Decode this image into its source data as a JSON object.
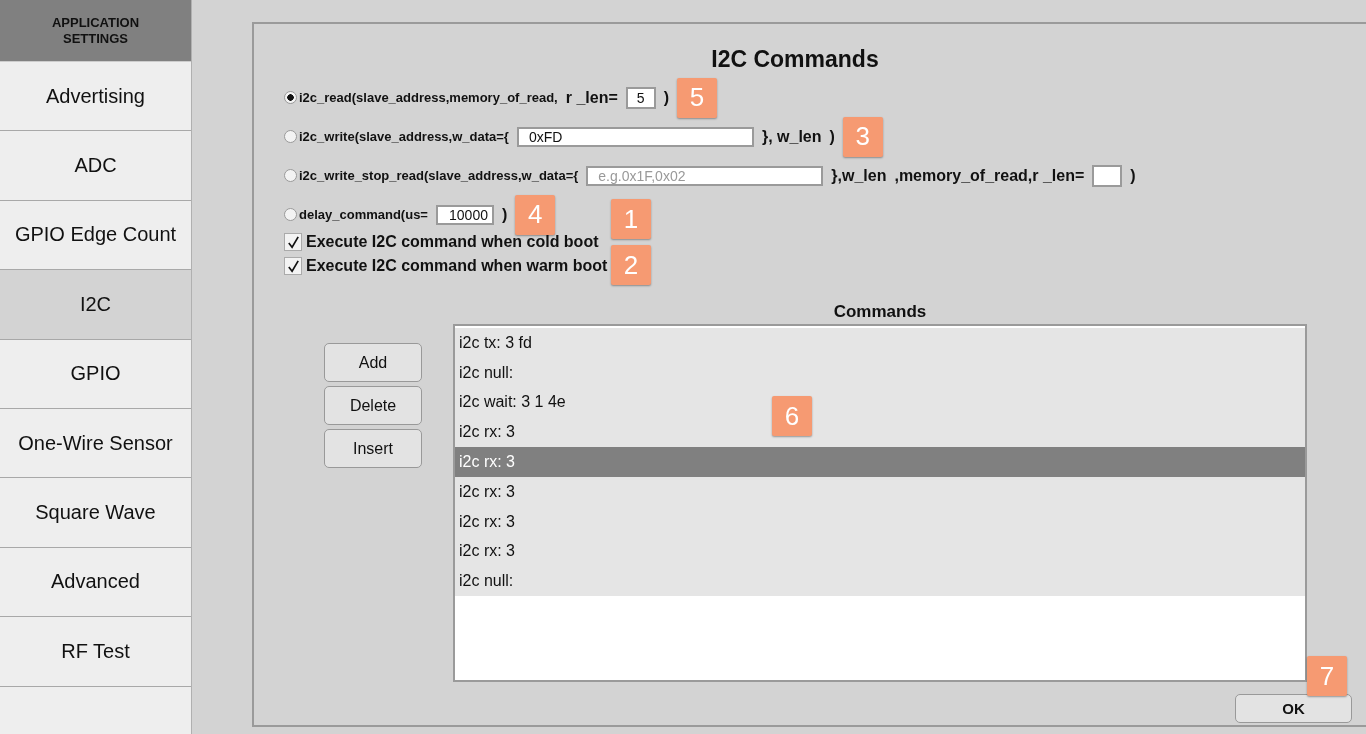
{
  "sidebar": {
    "header": "APPLICATION SETTINGS",
    "items": [
      {
        "label": "Advertising",
        "selected": false
      },
      {
        "label": "ADC",
        "selected": false
      },
      {
        "label": "GPIO Edge Count",
        "selected": false
      },
      {
        "label": "I2C",
        "selected": true
      },
      {
        "label": "GPIO",
        "selected": false
      },
      {
        "label": "One-Wire Sensor",
        "selected": false
      },
      {
        "label": "Square Wave",
        "selected": false
      },
      {
        "label": "Advanced",
        "selected": false
      },
      {
        "label": "RF Test",
        "selected": false
      }
    ]
  },
  "panel": {
    "title": "I2C Commands",
    "options": [
      {
        "kind": "radio",
        "selected": true,
        "parts": [
          {
            "kind": "text",
            "text": "i2c_read(slave_address,memory_of_read,"
          },
          {
            "kind": "label",
            "text": "r _len="
          },
          {
            "kind": "small-field",
            "value": "5"
          },
          {
            "kind": "label",
            "text": ")"
          },
          {
            "kind": "callout",
            "text": "5"
          }
        ]
      },
      {
        "kind": "radio",
        "selected": false,
        "parts": [
          {
            "kind": "text",
            "text": "i2c_write(slave_address,w_data={"
          },
          {
            "kind": "wide-field",
            "value": "0xFD"
          },
          {
            "kind": "label",
            "text": "}, w_len"
          },
          {
            "kind": "label",
            "text": ")"
          },
          {
            "kind": "callout",
            "text": "3"
          }
        ]
      },
      {
        "kind": "radio",
        "selected": false,
        "parts": [
          {
            "kind": "text",
            "text": "i2c_write_stop_read(slave_address,w_data={"
          },
          {
            "kind": "wide-field",
            "placeholder": "e.g.0x1F,0x02"
          },
          {
            "kind": "label",
            "text": "},w_len"
          },
          {
            "kind": "label",
            "text": ",memory_of_read,r _len="
          },
          {
            "kind": "small-field"
          },
          {
            "kind": "label",
            "text": ")"
          }
        ]
      },
      {
        "kind": "radio",
        "selected": false,
        "parts": [
          {
            "kind": "text",
            "text": "delay_command(us="
          },
          {
            "kind": "medium-field",
            "value": "10000"
          },
          {
            "kind": "label",
            "text": ")"
          },
          {
            "kind": "callout",
            "text": "4"
          }
        ]
      },
      {
        "kind": "checkbox",
        "checked": true,
        "parts": [
          {
            "kind": "label",
            "text": "Execute I2C command when cold boot"
          },
          {
            "kind": "callout",
            "text": "1"
          }
        ]
      },
      {
        "kind": "checkbox",
        "checked": true,
        "parts": [
          {
            "kind": "label",
            "text": "Execute I2C command when warm boot"
          },
          {
            "kind": "callout",
            "text": "2"
          }
        ]
      }
    ],
    "actions": [
      "Add",
      "Delete",
      "Insert"
    ],
    "commands": {
      "title": "Commands",
      "callout": "6",
      "items": [
        {
          "text": "i2c tx: 3 fd",
          "selected": false
        },
        {
          "text": "i2c null:",
          "selected": false
        },
        {
          "text": "i2c wait: 3 1 4e",
          "selected": false
        },
        {
          "text": "i2c rx: 3",
          "selected": false
        },
        {
          "text": "i2c rx: 3",
          "selected": true
        },
        {
          "text": "i2c rx: 3",
          "selected": false
        },
        {
          "text": "i2c rx: 3",
          "selected": false
        },
        {
          "text": "i2c rx: 3",
          "selected": false
        },
        {
          "text": "i2c null:",
          "selected": false
        }
      ]
    },
    "ok": {
      "label": "OK",
      "callout": "7"
    }
  }
}
